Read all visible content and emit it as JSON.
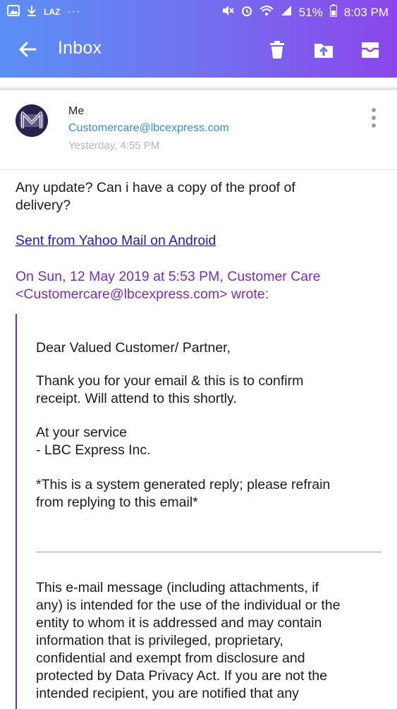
{
  "status_bar": {
    "carrier": "LAZ",
    "dots": "···",
    "battery": "51%",
    "time": "8:03 PM"
  },
  "app_bar": {
    "title": "Inbox",
    "icons": [
      "back-arrow-icon",
      "trash-icon",
      "move-to-folder-icon",
      "archive-icon"
    ]
  },
  "message": {
    "from": "Me",
    "to": "Customercare@lbcexpress.com",
    "time": "Yesterday, 4:55 PM",
    "body_line1": "Any update? Can i have a copy of the proof of",
    "body_line2": "delivery?",
    "signature_link": "Sent from Yahoo Mail on Android",
    "quote_header_line1": "On Sun, 12 May 2019 at 5:53 PM, Customer Care",
    "quote_header_line2": "<Customercare@lbcexpress.com> wrote:"
  },
  "quoted": {
    "greeting": "Dear Valued Customer/ Partner,",
    "thanks_line1": "Thank you for your email & this is to confirm",
    "thanks_line2": "receipt. Will attend to this shortly.",
    "service_line1": "At your service",
    "service_line2": "- LBC Express Inc.",
    "system_line1": "*This is a system generated reply; please refrain",
    "system_line2": "from replying to this email*",
    "disclaimer_lines": [
      "This e-mail message (including attachments, if",
      "any) is intended for the use of the individual or the",
      "entity to whom it is addressed and may contain",
      "information that is privileged, proprietary,",
      "confidential and exempt from disclosure and",
      "protected by Data Privacy Act. If you are not the",
      "intended recipient, you are notified that any"
    ]
  },
  "colors": {
    "header_gradient_start": "#5b8ff5",
    "header_gradient_end": "#8b46ea",
    "recipient_blue": "#2f8fd7",
    "quote_purple": "#7a2cc0",
    "link_blue": "#1a1ad6"
  }
}
